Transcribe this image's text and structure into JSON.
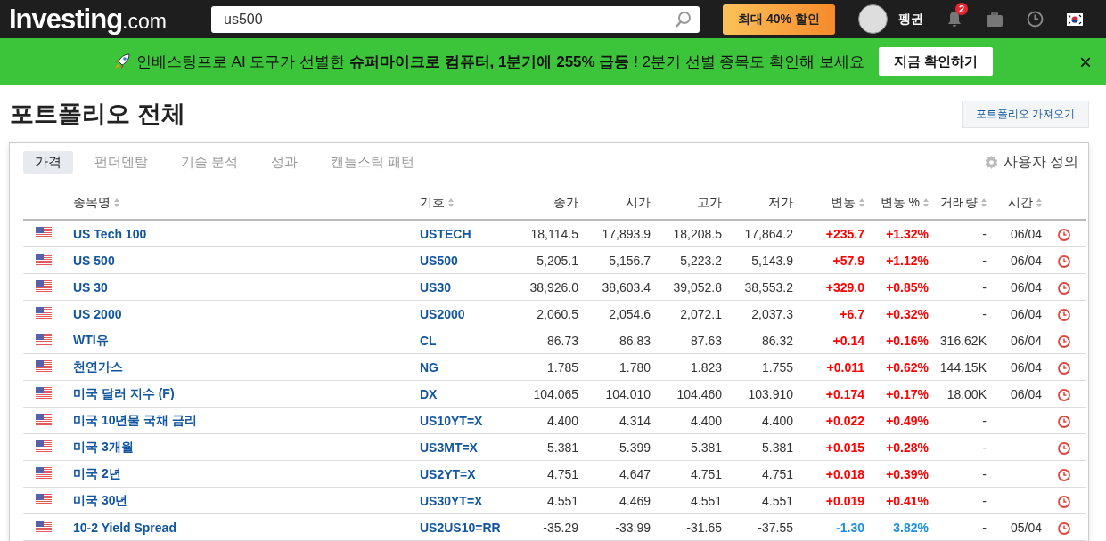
{
  "header": {
    "logo_main": "Investing",
    "logo_suffix": ".com",
    "search": {
      "value": "us500"
    },
    "promo_button": "최대 40% 할인",
    "user_name": "펭귄",
    "notification_count": "2"
  },
  "banner": {
    "text": "인베스팅프로 AI 도구가 선별한 **슈퍼마이크로 컴퓨터, 1분기에 255% 급등** ! 2분기 선별 종목도 확인해 보세요",
    "button": "지금 확인하기",
    "close": "×"
  },
  "page": {
    "title": "포트폴리오 전체",
    "import_button": "포트폴리오 가져오기"
  },
  "tabs": [
    {
      "label": "가격",
      "selected": true
    },
    {
      "label": "펀더멘탈",
      "selected": false
    },
    {
      "label": "기술 분석",
      "selected": false
    },
    {
      "label": "성과",
      "selected": false
    },
    {
      "label": "캔들스틱 패턴",
      "selected": false
    }
  ],
  "customize": "사용자 정의",
  "table": {
    "columns": [
      {
        "label": "종목명",
        "sortable": true
      },
      {
        "label": "기호",
        "sortable": true
      },
      {
        "label": "종가",
        "sortable": false
      },
      {
        "label": "시가",
        "sortable": false
      },
      {
        "label": "고가",
        "sortable": false
      },
      {
        "label": "저가",
        "sortable": false
      },
      {
        "label": "변동",
        "sortable": true
      },
      {
        "label": "변동 %",
        "sortable": true
      },
      {
        "label": "거래량",
        "sortable": true
      },
      {
        "label": "시간",
        "sortable": true
      }
    ],
    "rows": [
      {
        "name": "US Tech 100",
        "symbol": "USTECH",
        "close": "18,114.5",
        "open": "17,893.9",
        "high": "18,208.5",
        "low": "17,864.2",
        "change": "+235.7",
        "change_pct": "+1.32%",
        "color": "#ff0000",
        "volume": "-",
        "time": "06/04"
      },
      {
        "name": "US 500",
        "symbol": "US500",
        "close": "5,205.1",
        "open": "5,156.7",
        "high": "5,223.2",
        "low": "5,143.9",
        "change": "+57.9",
        "change_pct": "+1.12%",
        "color": "#ff0000",
        "volume": "-",
        "time": "06/04"
      },
      {
        "name": "US 30",
        "symbol": "US30",
        "close": "38,926.0",
        "open": "38,603.4",
        "high": "39,052.8",
        "low": "38,553.2",
        "change": "+329.0",
        "change_pct": "+0.85%",
        "color": "#ff0000",
        "volume": "-",
        "time": "06/04"
      },
      {
        "name": "US 2000",
        "symbol": "US2000",
        "close": "2,060.5",
        "open": "2,054.6",
        "high": "2,072.1",
        "low": "2,037.3",
        "change": "+6.7",
        "change_pct": "+0.32%",
        "color": "#ff0000",
        "volume": "-",
        "time": "06/04"
      },
      {
        "name": "WTI유",
        "symbol": "CL",
        "close": "86.73",
        "open": "86.83",
        "high": "87.63",
        "low": "86.32",
        "change": "+0.14",
        "change_pct": "+0.16%",
        "color": "#ff0000",
        "volume": "316.62K",
        "time": "06/04"
      },
      {
        "name": "천연가스",
        "symbol": "NG",
        "close": "1.785",
        "open": "1.780",
        "high": "1.823",
        "low": "1.755",
        "change": "+0.011",
        "change_pct": "+0.62%",
        "color": "#ff0000",
        "volume": "144.15K",
        "time": "06/04"
      },
      {
        "name": "미국 달러 지수 (F)",
        "symbol": "DX",
        "close": "104.065",
        "open": "104.010",
        "high": "104.460",
        "low": "103.910",
        "change": "+0.174",
        "change_pct": "+0.17%",
        "color": "#ff0000",
        "volume": "18.00K",
        "time": "06/04"
      },
      {
        "name": "미국 10년물 국채 금리",
        "symbol": "US10YT=X",
        "close": "4.400",
        "open": "4.314",
        "high": "4.400",
        "low": "4.400",
        "change": "+0.022",
        "change_pct": "+0.49%",
        "color": "#ff0000",
        "volume": "-"
      },
      {
        "name": "미국 3개월",
        "symbol": "US3MT=X",
        "close": "5.381",
        "open": "5.399",
        "high": "5.381",
        "low": "5.381",
        "change": "+0.015",
        "change_pct": "+0.28%",
        "color": "#ff0000",
        "volume": "-"
      },
      {
        "name": "미국 2년",
        "symbol": "US2YT=X",
        "close": "4.751",
        "open": "4.647",
        "high": "4.751",
        "low": "4.751",
        "change": "+0.018",
        "change_pct": "+0.39%",
        "color": "#ff0000",
        "volume": "-"
      },
      {
        "name": "미국 30년",
        "symbol": "US30YT=X",
        "close": "4.551",
        "open": "4.469",
        "high": "4.551",
        "low": "4.551",
        "change": "+0.019",
        "change_pct": "+0.41%",
        "color": "#ff0000",
        "volume": "-"
      },
      {
        "name": "10-2 Yield Spread",
        "symbol": "US2US10=RR",
        "close": "-35.29",
        "open": "-33.99",
        "high": "-31.65",
        "low": "-37.55",
        "change": "-1.30",
        "change_pct": "3.82%",
        "color": "#1a8fe3",
        "volume": "-",
        "time": "05/04"
      }
    ]
  }
}
